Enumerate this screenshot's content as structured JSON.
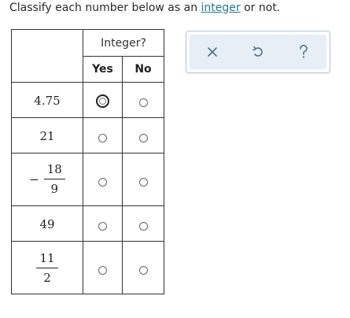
{
  "prompt": {
    "before": "Classify each number below as an ",
    "link": "integer",
    "after": " or not."
  },
  "table": {
    "group_header": "Integer?",
    "yes_label": "Yes",
    "no_label": "No",
    "rows": [
      {
        "display": "4.75"
      },
      {
        "display": "21"
      },
      {
        "sign": "−",
        "numerator": "18",
        "denominator": "9"
      },
      {
        "display": "49"
      },
      {
        "numerator": "11",
        "denominator": "2"
      }
    ]
  },
  "toolbar": {
    "icons": [
      "close-icon",
      "undo-icon",
      "help-icon"
    ],
    "accent_color": "#4a6f8f"
  },
  "colors": {
    "link": "#1f7a99",
    "toolbar_bg": "#e8eef5",
    "toolbar_border": "#b7c8d8"
  }
}
